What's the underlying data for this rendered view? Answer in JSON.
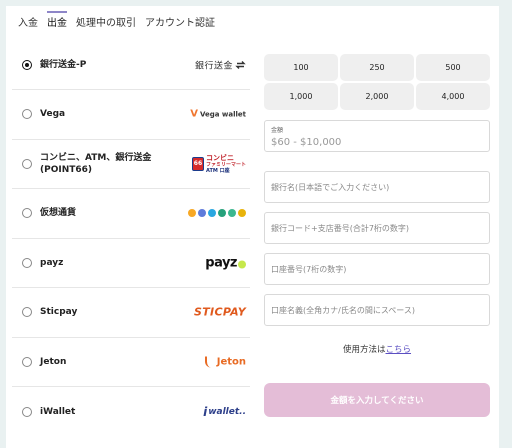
{
  "tabs": [
    {
      "label": "入金",
      "active": false
    },
    {
      "label": "出金",
      "active": true
    },
    {
      "label": "処理中の取引",
      "active": false
    },
    {
      "label": "アカウント認証",
      "active": false
    }
  ],
  "methods": [
    {
      "label": "銀行送金-P",
      "logo_text": "銀行送金",
      "logo_icon": "exchange-icon",
      "selected": true
    },
    {
      "label": "Vega",
      "logo_text": "Vega wallet",
      "logo_icon": "vega-logo-icon",
      "selected": false
    },
    {
      "label": "コンビニ、ATM、銀行送金 (POINT66)",
      "logo_badge": "66",
      "logo_text": "コンビニ",
      "logo_sub1": "ファミリーマート",
      "logo_sub2": "ATM 口座",
      "selected": false
    },
    {
      "label": "仮想通貨",
      "logo_icon": "crypto-coins-icon",
      "selected": false
    },
    {
      "label": "payz",
      "logo_text": "payz",
      "selected": false
    },
    {
      "label": "Sticpay",
      "logo_text": "STICPAY",
      "selected": false
    },
    {
      "label": "Jeton",
      "logo_text": "Jeton",
      "selected": false
    },
    {
      "label": "iWallet",
      "logo_text": "wallet..",
      "logo_prefix": "i",
      "selected": false
    }
  ],
  "quick_amounts": [
    "100",
    "250",
    "500",
    "1,000",
    "2,000",
    "4,000"
  ],
  "amount_field": {
    "label": "金額",
    "placeholder": "$60 - $10,000"
  },
  "fields": [
    {
      "placeholder": "銀行名(日本語でご入力ください)"
    },
    {
      "placeholder": "銀行コード+支店番号(合計7桁の数字)"
    },
    {
      "placeholder": "口座番号(7桁の数字)"
    },
    {
      "placeholder": "口座名義(全角カナ/氏名の間にスペース)"
    }
  ],
  "howto": {
    "text": "使用方法は",
    "link": "こちら"
  },
  "submit_label": "金額を入力してください",
  "colors": {
    "accent": "#8e86c8",
    "submit_bg": "#e4bdd7",
    "link": "#5b4fc2",
    "background": "#e9f1f1"
  }
}
